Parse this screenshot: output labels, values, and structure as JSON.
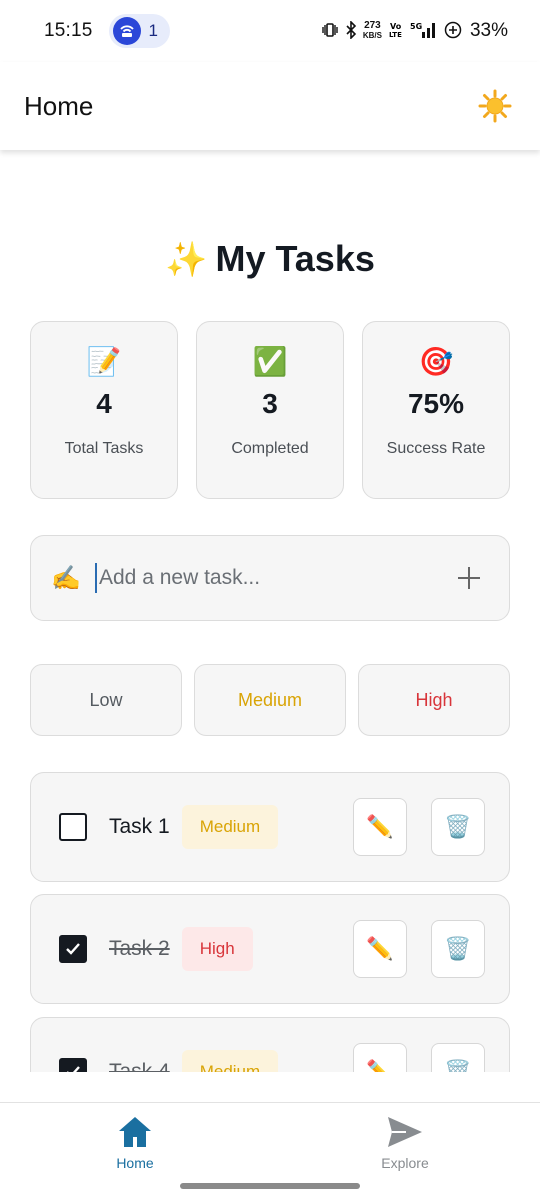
{
  "status_bar": {
    "time": "15:15",
    "notification_count": "1",
    "net_speed_value": "273",
    "net_speed_unit": "KB/S",
    "battery": "33%"
  },
  "appbar": {
    "title": "Home",
    "theme_icon": "sun-icon"
  },
  "page": {
    "title_emoji": "✨",
    "title": "My Tasks"
  },
  "stats": [
    {
      "icon": "📝",
      "value": "4",
      "label": "Total Tasks"
    },
    {
      "icon": "✅",
      "value": "3",
      "label": "Completed"
    },
    {
      "icon": "🎯",
      "value": "75%",
      "label": "Success Rate"
    }
  ],
  "add_task": {
    "emoji": "✍️",
    "placeholder": "Add a new task...",
    "button_icon": "plus-icon"
  },
  "priorities": [
    {
      "label": "Low",
      "color": "#555b61"
    },
    {
      "label": "Medium",
      "color": "#d9a406"
    },
    {
      "label": "High",
      "color": "#d8353a"
    }
  ],
  "tasks": [
    {
      "name": "Task 1",
      "completed": false,
      "priority": "Medium"
    },
    {
      "name": "Task 2",
      "completed": true,
      "priority": "High"
    },
    {
      "name": "Task 4",
      "completed": true,
      "priority": "Medium"
    }
  ],
  "task_actions": {
    "edit_icon": "✏️",
    "delete_icon": "🗑️"
  },
  "colors": {
    "medium_text": "#d9a406",
    "medium_bg": "#fcf3dc",
    "high_text": "#d8353a",
    "high_bg": "#fde8e8",
    "nav_active": "#1a6fa0",
    "nav_inactive": "#888c90"
  },
  "bottom_nav": [
    {
      "label": "Home",
      "icon": "home-icon",
      "active": true
    },
    {
      "label": "Explore",
      "icon": "send-icon",
      "active": false
    }
  ]
}
